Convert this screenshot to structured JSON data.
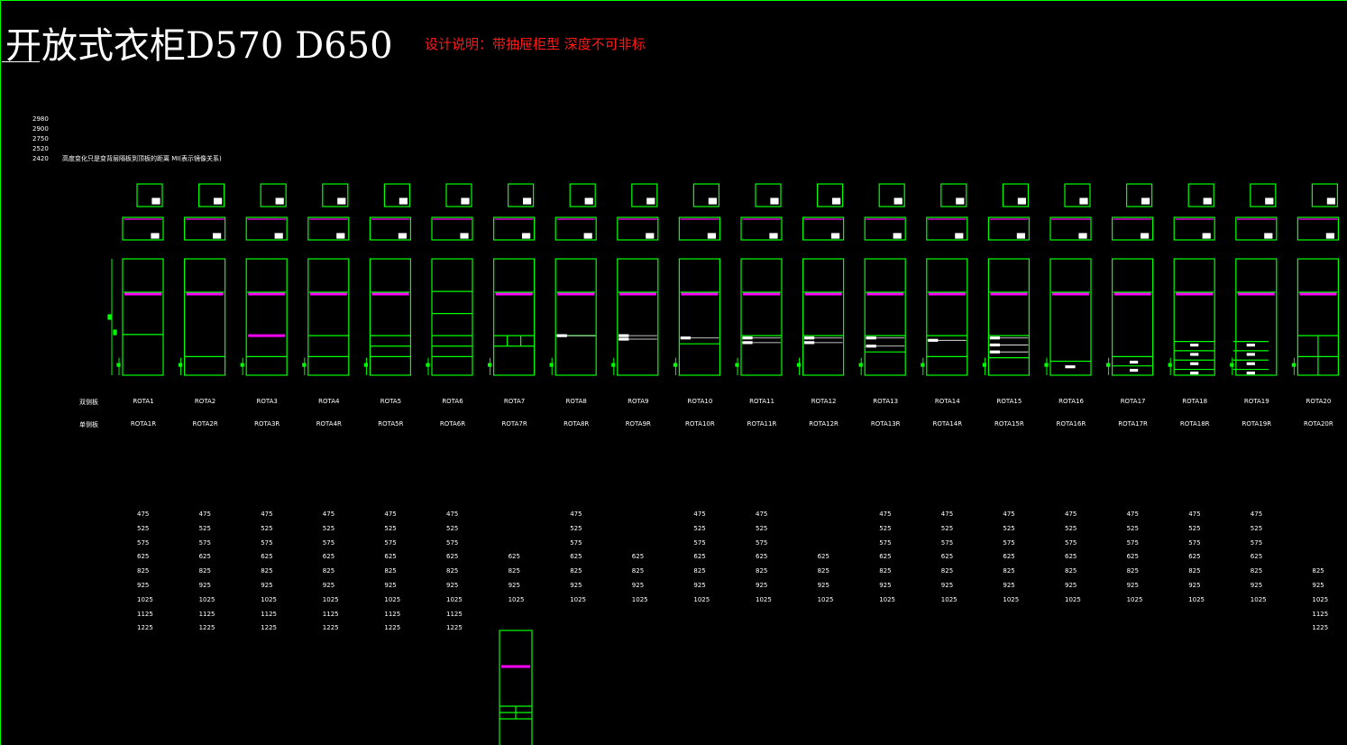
{
  "title": "开放式衣柜D570 D650",
  "design_note": "设计说明：带抽屉柜型 深度不可非标",
  "heights": [
    "2980",
    "2900",
    "2750",
    "2520",
    "2420"
  ],
  "height_note": "高度变化只是变背层隔板到顶板的距离   MI(表示镜像关系)",
  "row_labels": {
    "double": "双侧板",
    "single": "单侧板"
  },
  "wardrobes": [
    {
      "double": "ROTA1",
      "single": "ROTA1R",
      "widths": [
        "475",
        "525",
        "575",
        "625",
        "825",
        "925",
        "1025",
        "1125",
        "1225"
      ]
    },
    {
      "double": "ROTA2",
      "single": "ROTA2R",
      "widths": [
        "475",
        "525",
        "575",
        "625",
        "825",
        "925",
        "1025",
        "1125",
        "1225"
      ]
    },
    {
      "double": "ROTA3",
      "single": "ROTA3R",
      "widths": [
        "475",
        "525",
        "575",
        "625",
        "825",
        "925",
        "1025",
        "1125",
        "1225"
      ]
    },
    {
      "double": "ROTA4",
      "single": "ROTA4R",
      "widths": [
        "475",
        "525",
        "575",
        "625",
        "825",
        "925",
        "1025",
        "1125",
        "1225"
      ]
    },
    {
      "double": "ROTA5",
      "single": "ROTA5R",
      "widths": [
        "475",
        "525",
        "575",
        "625",
        "825",
        "925",
        "1025",
        "1125",
        "1225"
      ]
    },
    {
      "double": "ROTA6",
      "single": "ROTA6R",
      "widths": [
        "475",
        "525",
        "575",
        "625",
        "825",
        "925",
        "1025",
        "1125",
        "1225"
      ]
    },
    {
      "double": "ROTA7",
      "single": "ROTA7R",
      "widths": [
        "",
        "",
        "",
        "625",
        "825",
        "925",
        "1025",
        "",
        ""
      ]
    },
    {
      "double": "ROTA8",
      "single": "ROTA8R",
      "widths": [
        "475",
        "525",
        "575",
        "625",
        "825",
        "925",
        "1025",
        "",
        ""
      ]
    },
    {
      "double": "ROTA9",
      "single": "ROTA9R",
      "widths": [
        "",
        "",
        "",
        "625",
        "825",
        "925",
        "1025",
        "",
        ""
      ]
    },
    {
      "double": "ROTA10",
      "single": "ROTA10R",
      "widths": [
        "475",
        "525",
        "575",
        "625",
        "825",
        "925",
        "1025",
        "",
        ""
      ]
    },
    {
      "double": "ROTA11",
      "single": "ROTA11R",
      "widths": [
        "475",
        "525",
        "575",
        "625",
        "825",
        "925",
        "1025",
        "",
        ""
      ]
    },
    {
      "double": "ROTA12",
      "single": "ROTA12R",
      "widths": [
        "",
        "",
        "",
        "625",
        "825",
        "925",
        "1025",
        "",
        ""
      ]
    },
    {
      "double": "ROTA13",
      "single": "ROTA13R",
      "widths": [
        "475",
        "525",
        "575",
        "625",
        "825",
        "925",
        "1025",
        "",
        ""
      ]
    },
    {
      "double": "ROTA14",
      "single": "ROTA14R",
      "widths": [
        "475",
        "525",
        "575",
        "625",
        "825",
        "925",
        "1025",
        "",
        ""
      ]
    },
    {
      "double": "ROTA15",
      "single": "ROTA15R",
      "widths": [
        "475",
        "525",
        "575",
        "625",
        "825",
        "925",
        "1025",
        "",
        ""
      ]
    },
    {
      "double": "ROTA16",
      "single": "ROTA16R",
      "widths": [
        "475",
        "525",
        "575",
        "625",
        "825",
        "925",
        "1025",
        "",
        ""
      ]
    },
    {
      "double": "ROTA17",
      "single": "ROTA17R",
      "widths": [
        "475",
        "525",
        "575",
        "625",
        "825",
        "925",
        "1025",
        "",
        ""
      ]
    },
    {
      "double": "ROTA18",
      "single": "ROTA18R",
      "widths": [
        "475",
        "525",
        "575",
        "625",
        "825",
        "925",
        "1025",
        "",
        ""
      ]
    },
    {
      "double": "ROTA19",
      "single": "ROTA19R",
      "widths": [
        "475",
        "525",
        "575",
        "625",
        "825",
        "925",
        "1025",
        "",
        ""
      ]
    },
    {
      "double": "ROTA20",
      "single": "ROTA20R",
      "widths": [
        "",
        "",
        "",
        "",
        "825",
        "925",
        "1025",
        "1125",
        "1225"
      ]
    }
  ],
  "colors": {
    "line": "#00ff00",
    "rail": "#ff00ff",
    "note": "#ff1a1a",
    "text": "#ffffff",
    "background": "#000000"
  }
}
